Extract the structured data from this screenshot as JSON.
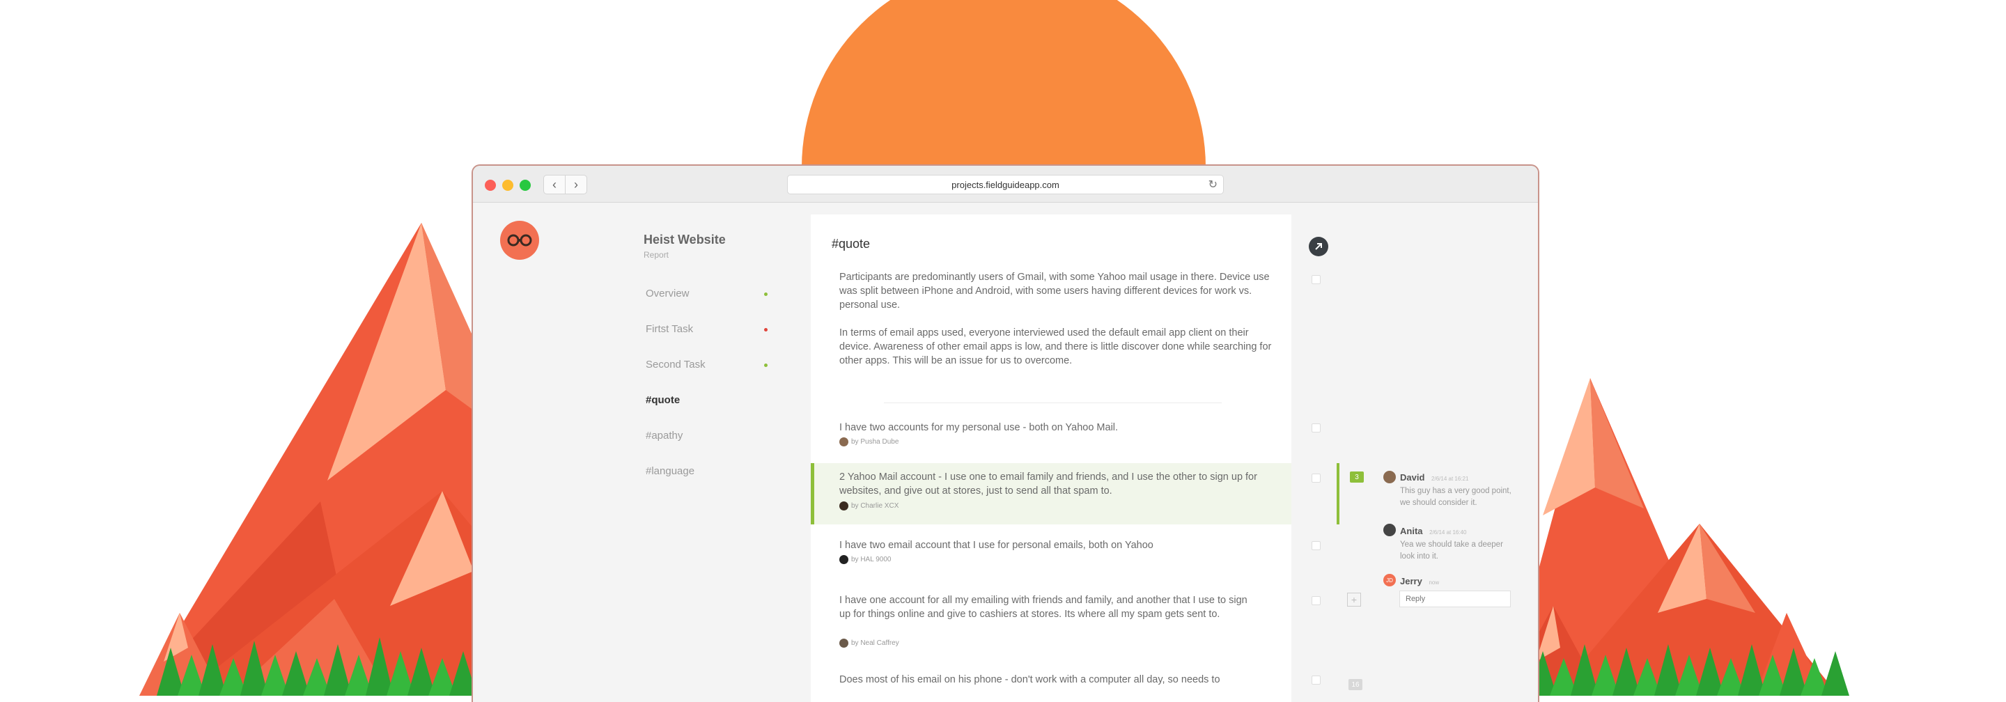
{
  "browser": {
    "url": "projects.fieldguideapp.com"
  },
  "project": {
    "title": "Heist Website",
    "subtitle": "Report"
  },
  "sidebar": {
    "items": [
      {
        "label": "Overview",
        "dot": "#8ebf3a"
      },
      {
        "label": "Firtst Task",
        "dot": "#e0443b"
      },
      {
        "label": "Second Task",
        "dot": "#8ebf3a"
      },
      {
        "label": "#quote",
        "active": true
      },
      {
        "label": "#apathy"
      },
      {
        "label": "#language"
      }
    ]
  },
  "main": {
    "title": "#quote",
    "summary_1": "Participants are predominantly users of Gmail, with some Yahoo mail usage in there. Device use was split between iPhone and Android, with some users having different devices for work vs. personal use.",
    "summary_2": "In terms of email apps used, everyone interviewed used the default email app client on their device. Awareness of other email apps is low, and there is little discover done while searching for other apps. This will be an issue for us to overcome.",
    "notes": [
      {
        "text": "I have two accounts for my personal use - both on Yahoo Mail.",
        "by": "by Pusha Dube"
      },
      {
        "text": "2 Yahoo Mail account - I use one to email family and friends, and I use the other to sign up for websites, and give out at stores, just to send all that spam to.",
        "by": "by Charlie XCX"
      },
      {
        "text": "I have two email account that I use for personal emails, both on Yahoo",
        "by": "by HAL 9000"
      },
      {
        "text": "I have one account for all my emailing with friends and family, and another that I use to sign up for things online and give to cashiers at stores. Its where all my spam gets sent to.",
        "by": "by Neal Caffrey"
      },
      {
        "text": "Does most of his email on his phone - don't work with a computer all day, so needs to"
      }
    ]
  },
  "comments": {
    "count": "3",
    "count_bottom": "16",
    "items": [
      {
        "name": "David",
        "time": "2/6/14 at 16:21",
        "text": "This guy has a very good point, we should consider it."
      },
      {
        "name": "Anita",
        "time": "2/6/14 at 16:40",
        "text": "Yea we should take a deeper look into it."
      },
      {
        "name": "Jerry",
        "time": "now",
        "initials": "JD"
      }
    ],
    "reply_placeholder": "Reply"
  },
  "colors": {
    "accent": "#f27052",
    "highlight": "#8ebf3a",
    "sun": "#f98a3e"
  }
}
